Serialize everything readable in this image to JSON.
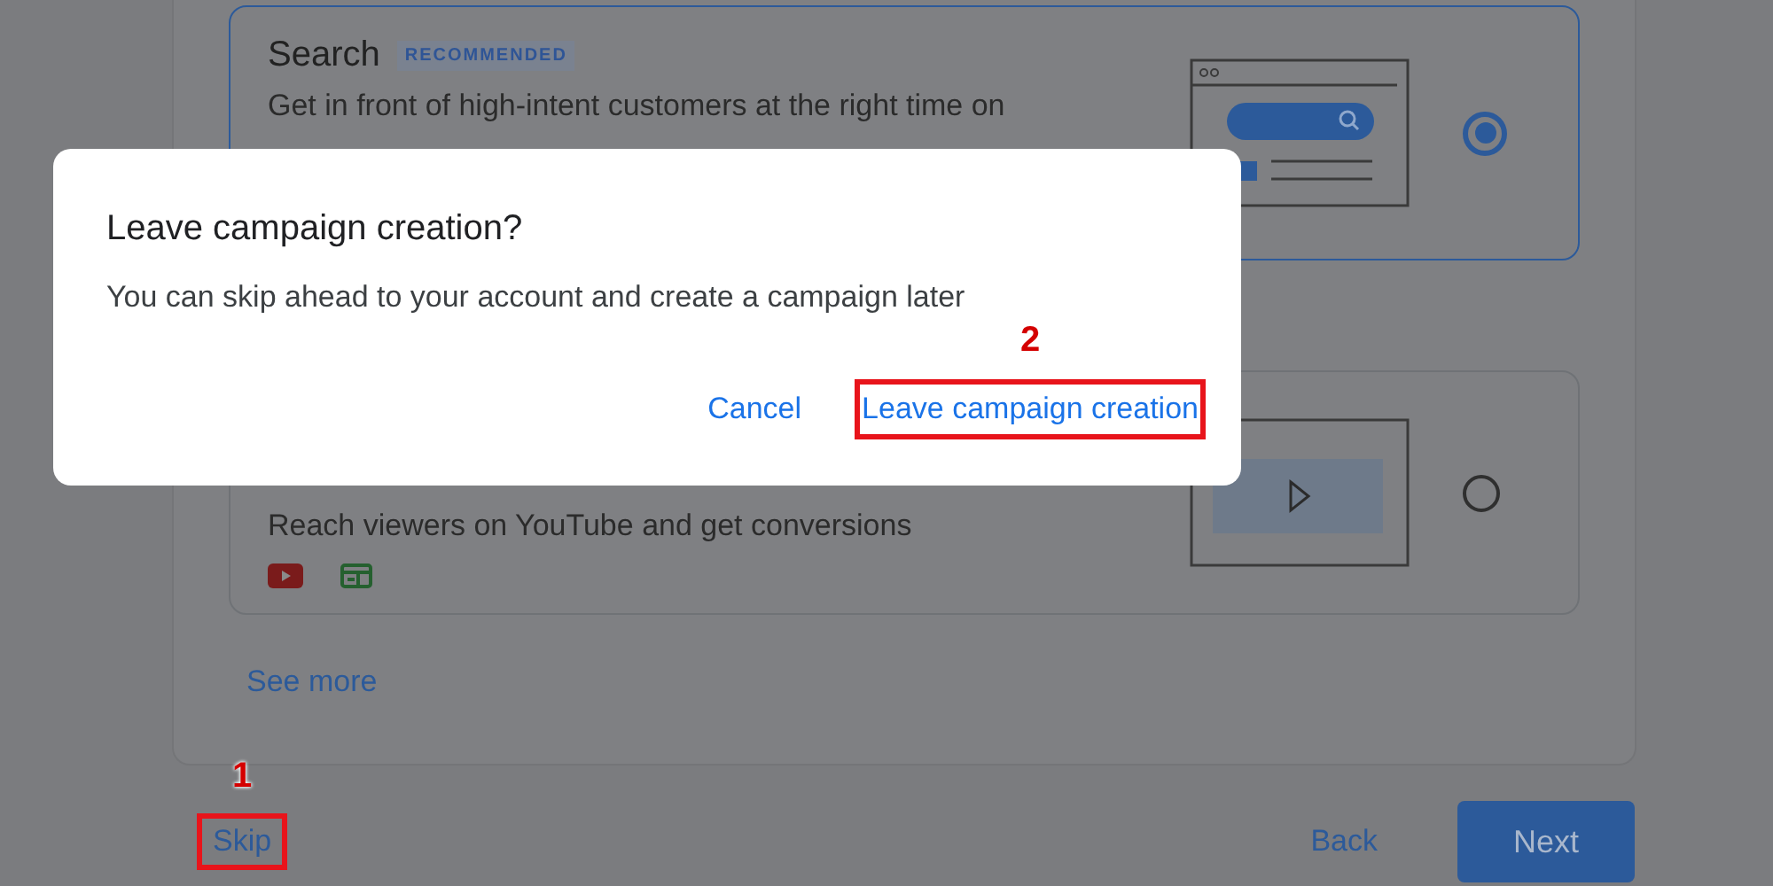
{
  "options": [
    {
      "kind": "search",
      "title": "Search",
      "badge": "RECOMMENDED",
      "description": "Get in front of high-intent customers at the right time on",
      "selected": true
    },
    {
      "kind": "video",
      "description": "Reach viewers on YouTube and get conversions",
      "selected": false
    }
  ],
  "see_more": "See more",
  "footer": {
    "skip": {
      "label": "Skip",
      "annotation": "1"
    },
    "back": "Back",
    "next": "Next"
  },
  "dialog": {
    "title": "Leave campaign creation?",
    "message": "You can skip ahead to your account and create a campaign later",
    "buttons": [
      {
        "label": "Cancel"
      },
      {
        "label": "Leave campaign creation",
        "annotation": "2"
      }
    ]
  }
}
